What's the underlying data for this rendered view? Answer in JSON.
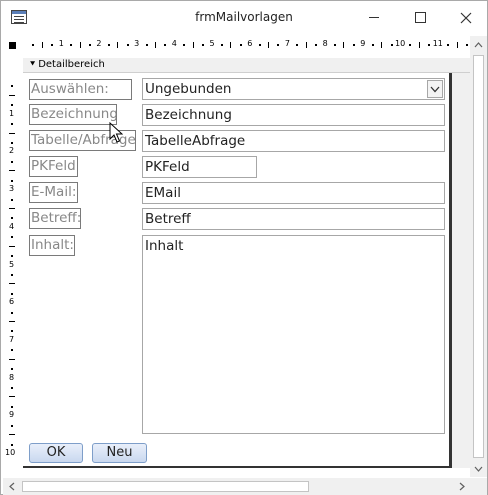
{
  "window": {
    "title": "frmMailvorlagen"
  },
  "ruler": {
    "horizontal": [
      "1",
      "2",
      "3",
      "4",
      "5",
      "6",
      "7",
      "8",
      "9",
      "10",
      "11"
    ],
    "vertical": [
      "1",
      "2",
      "3",
      "4",
      "5",
      "6",
      "7",
      "8",
      "9",
      "10"
    ]
  },
  "section": {
    "label": "Detailbereich"
  },
  "form": {
    "rows": [
      {
        "label": "Auswählen:",
        "value": "Ungebunden",
        "control": "combo"
      },
      {
        "label": "Bezeichnung:",
        "value": "Bezeichnung",
        "control": "text"
      },
      {
        "label": "Tabelle/Abfrage:",
        "value": "TabelleAbfrage",
        "control": "text"
      },
      {
        "label": "PKFeld",
        "value": "PKFeld",
        "control": "text"
      },
      {
        "label": "E-Mail:",
        "value": "EMail",
        "control": "text"
      },
      {
        "label": "Betreff:",
        "value": "Betreff",
        "control": "text"
      },
      {
        "label": "Inhalt:",
        "value": "Inhalt",
        "control": "memo"
      }
    ]
  },
  "buttons": {
    "ok": "OK",
    "new": "Neu"
  },
  "icons": {
    "app": "form-icon",
    "minimize": "minimize-icon",
    "maximize": "maximize-icon",
    "close": "close-icon",
    "dropdown": "chevron-down-icon",
    "section": "section-arrow-icon",
    "cursor": "mouse-pointer-icon"
  },
  "colors": {
    "label_text": "#888888",
    "button_border": "#7e9ec9"
  }
}
